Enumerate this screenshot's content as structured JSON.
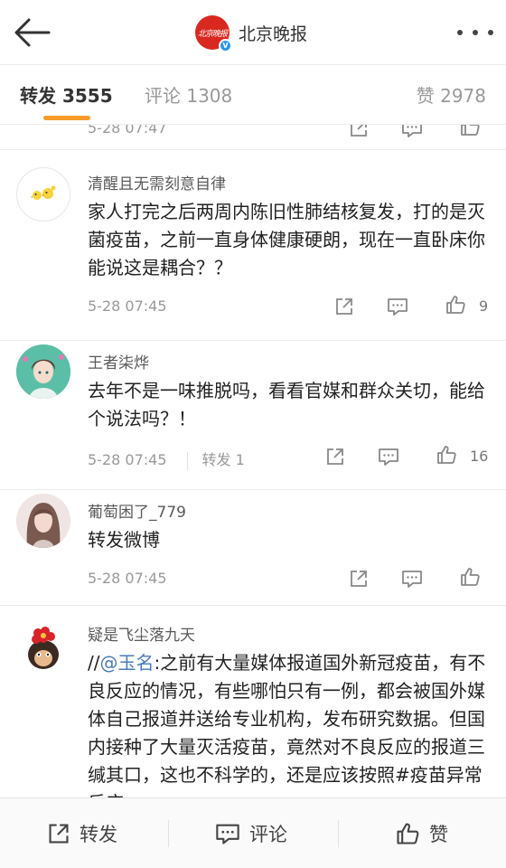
{
  "header": {
    "title": "北京晚报",
    "logo_text": "北京晚报",
    "verified_badge": "V"
  },
  "tabs": {
    "repost": "转发 3555",
    "comment": "评论 1308",
    "like": "赞 2978"
  },
  "feed": {
    "partial_item": {
      "time": "5-28 07:47"
    },
    "items": [
      {
        "username": "清醒且无需刻意自律",
        "content": "家人打完之后两周内陈旧性肺结核复发，打的是灭菌疫苗，之前一直身体健康硬朗，现在一直卧床你能说这是耦合？？",
        "time": "5-28 07:45",
        "likes": "9"
      },
      {
        "username": "王者柒烨",
        "content": "去年不是一味推脱吗，看看官媒和群众关切，能给个说法吗？！",
        "time": "5-28 07:45",
        "reposts": "转发 1",
        "likes": "16"
      },
      {
        "username": "葡萄困了_779",
        "content": "转发微博",
        "time": "5-28 07:45"
      },
      {
        "username": "疑是飞尘落九天",
        "content_prefix": "//",
        "mention": "@玉名",
        "content": ":之前有大量媒体报道国外新冠疫苗，有不良反应的情况，有些哪怕只有一例，都会被国外媒体自己报道并送给专业机构，发布研究数据。但国内接种了大量灭活疫苗，竟然对不良反应的报道三缄其口，这也不科学的，还是应该按照#疫苗异常反应"
      }
    ]
  },
  "bottom_bar": {
    "repost": "转发",
    "comment": "评论",
    "like": "赞"
  },
  "colors": {
    "accent": "#f79b29",
    "link": "#4a7bb7",
    "brand_red": "#d9281f",
    "verified_blue": "#2a95ea"
  },
  "icons": [
    "back-arrow-icon",
    "more-icon",
    "share-icon",
    "comment-icon",
    "like-icon"
  ]
}
